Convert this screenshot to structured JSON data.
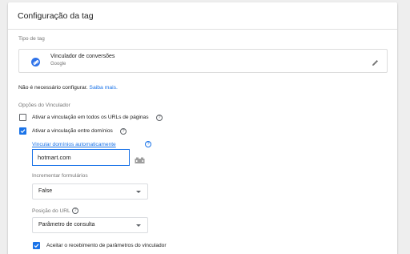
{
  "card": {
    "title": "Configuração da tag"
  },
  "tag_type": {
    "section_label": "Tipo de tag",
    "name": "Vinculador de conversões",
    "vendor": "Google"
  },
  "info": {
    "text": "Não é necessário configurar. ",
    "link": "Saiba mais."
  },
  "linker_options": {
    "section_label": "Opções do Vinculador",
    "option_all_urls": {
      "label": "Ativar a vinculação em todos os URLs de páginas",
      "checked": false
    },
    "option_cross_domain": {
      "label": "Ativar a vinculação entre domínios",
      "checked": true
    },
    "auto_link_label": "Vincular domínios automaticamente",
    "auto_link_value": "hotmart.com",
    "decorate_forms_label": "Incrementar formulários",
    "decorate_forms_value": "False",
    "url_position_label": "Posição do URL",
    "url_position_value": "Parâmetro de consulta",
    "accept_incoming": {
      "label": "Aceitar o recebimento de parâmetros do vinculador",
      "checked": true
    }
  },
  "colors": {
    "accent": "#1a73e8",
    "icon_blue": "#2f73e9"
  }
}
